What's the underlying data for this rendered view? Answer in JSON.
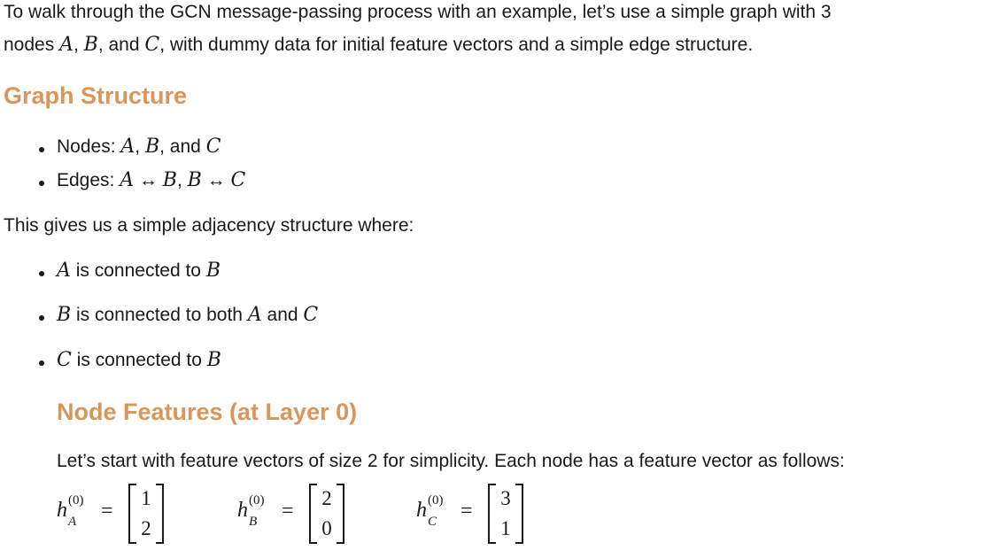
{
  "intro": {
    "line1": "To walk through the GCN message-passing process with an example, let’s use a simple graph with 3",
    "line2_a": "nodes ",
    "A": "A",
    ",": ",",
    "B": "B",
    "and": ", and ",
    "C": "C",
    "line2_b": ", with dummy data for initial feature vectors and a simple edge structure."
  },
  "graph_structure": {
    "heading": "Graph Structure",
    "nodes_label": "Nodes: ",
    "edges_label": "Edges: ",
    "arrow": "↔",
    "comma": ", ",
    "and": ", and "
  },
  "adjacency": {
    "intro": "This gives us a simple adjacency structure where:",
    "a_text": " is connected to ",
    "b_text": " is connected to both ",
    "and": " and ",
    "c_text": " is connected to "
  },
  "node_features": {
    "heading": "Node Features (at Layer 0)",
    "text": "Let’s start with feature vectors of size 2 for simplicity. Each node has a feature vector as follows:",
    "h": "h",
    "sup": "(0)",
    "eq": "=",
    "vectors": [
      {
        "node": "A",
        "values": [
          "1",
          "2"
        ]
      },
      {
        "node": "B",
        "values": [
          "2",
          "0"
        ]
      },
      {
        "node": "C",
        "values": [
          "3",
          "1"
        ]
      }
    ]
  },
  "colors": {
    "heading": "#d9955a"
  }
}
